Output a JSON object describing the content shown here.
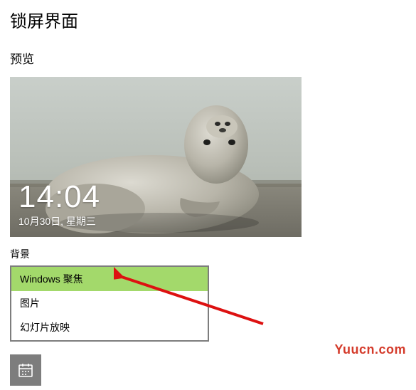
{
  "page_title": "锁屏界面",
  "preview_label": "预览",
  "preview_time": "14:04",
  "preview_date": "10月30日, 星期三",
  "background_label": "背景",
  "dropdown": {
    "options": [
      {
        "label": "Windows 聚焦",
        "selected": true
      },
      {
        "label": "图片",
        "selected": false
      },
      {
        "label": "幻灯片放映",
        "selected": false
      }
    ]
  },
  "watermark": "Yuucn.com"
}
